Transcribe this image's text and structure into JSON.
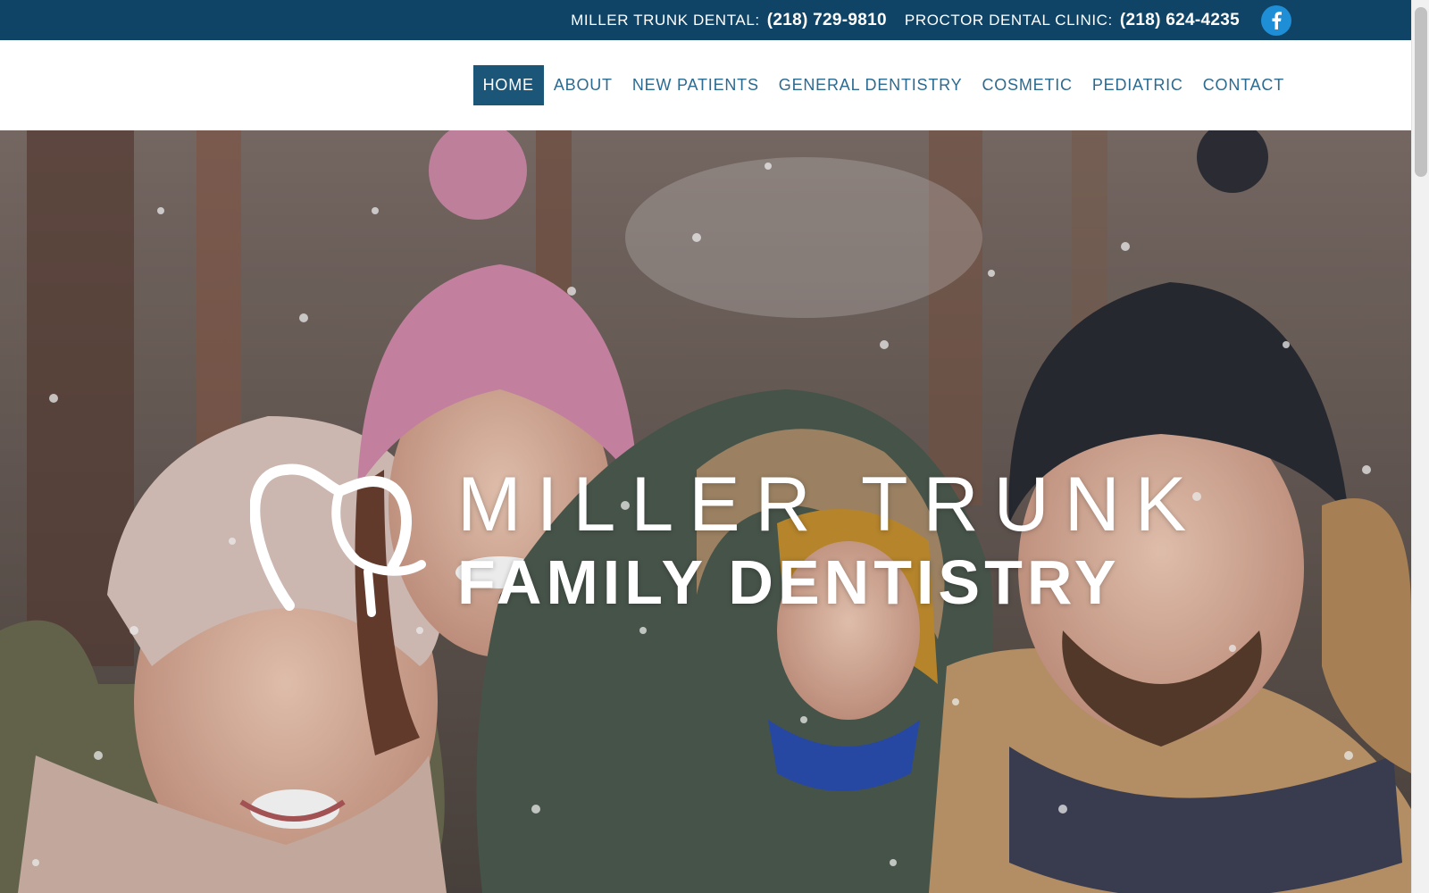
{
  "topbar": {
    "contacts": [
      {
        "label": "MILLER TRUNK DENTAL:",
        "phone": "(218) 729-9810"
      },
      {
        "label": "PROCTOR DENTAL CLINIC:",
        "phone": "(218) 624-4235"
      }
    ],
    "social_icon": "facebook-icon",
    "colors": {
      "background": "#0f4466",
      "facebook": "#1e8ed6"
    }
  },
  "nav": {
    "items": [
      {
        "label": "HOME",
        "active": true
      },
      {
        "label": "ABOUT",
        "active": false
      },
      {
        "label": "NEW PATIENTS",
        "active": false
      },
      {
        "label": "GENERAL DENTISTRY",
        "active": false
      },
      {
        "label": "COSMETIC",
        "active": false
      },
      {
        "label": "PEDIATRIC",
        "active": false
      },
      {
        "label": "CONTACT",
        "active": false
      }
    ],
    "colors": {
      "text": "#2c6a90",
      "active_bg": "#1b5679"
    }
  },
  "hero": {
    "logo_icon": "tooth-icon",
    "logo_line1": "MILLER TRUNK",
    "logo_line2": "FAMILY DENTISTRY"
  }
}
